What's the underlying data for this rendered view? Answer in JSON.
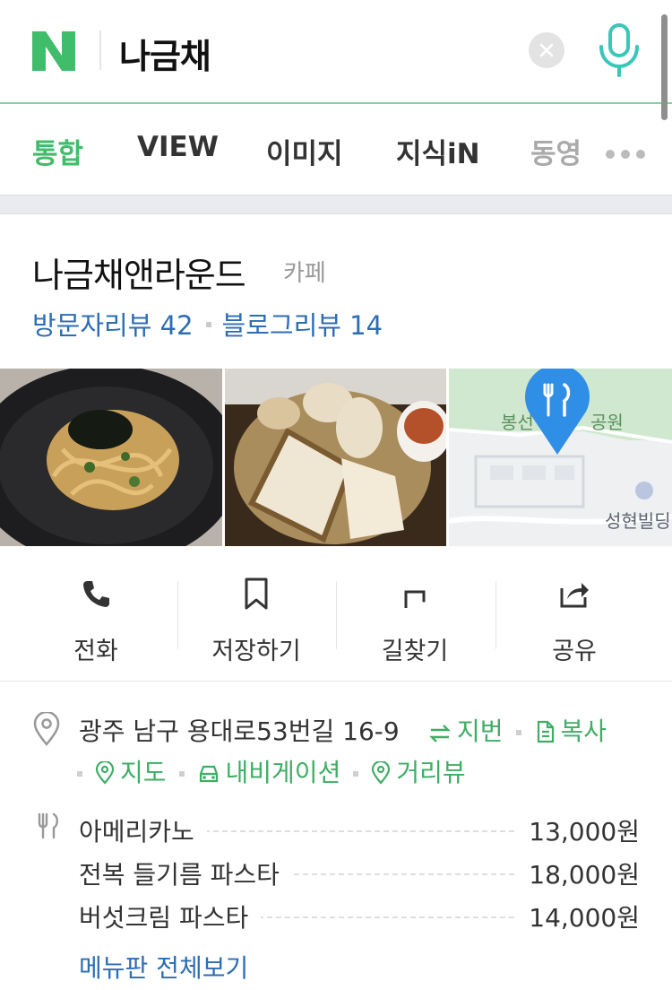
{
  "search": {
    "logo": "N",
    "query": "나금채"
  },
  "tabs": [
    {
      "label": "통합"
    },
    {
      "label": "VIEW"
    },
    {
      "label": "이미지"
    },
    {
      "label": "지식iN"
    },
    {
      "label": "동영"
    }
  ],
  "place": {
    "name": "나금채앤라운드",
    "category": "카페",
    "visitor_reviews": "방문자리뷰 42",
    "blog_reviews": "블로그리뷰 14"
  },
  "photos": [
    {
      "alt": "pasta-dish"
    },
    {
      "alt": "bread-basket"
    },
    {
      "alt": "map-thumbnail",
      "map_label_1": "봉선",
      "map_label_2": "공원",
      "map_label_3": "성현빌딩"
    }
  ],
  "actions": [
    {
      "label": "전화",
      "icon": "phone-icon"
    },
    {
      "label": "저장하기",
      "icon": "bookmark-icon"
    },
    {
      "label": "길찾기",
      "icon": "directions-icon"
    },
    {
      "label": "공유",
      "icon": "share-icon"
    }
  ],
  "address": {
    "text": "광주 남구 용대로53번길 16-9",
    "lot_number": "지번",
    "copy": "복사",
    "map": "지도",
    "navigation": "내비게이션",
    "street_view": "거리뷰"
  },
  "menu": {
    "items": [
      {
        "name": "아메리카노",
        "price": "13,000원"
      },
      {
        "name": "전복 들기름 파스타",
        "price": "18,000원"
      },
      {
        "name": "버섯크림 파스타",
        "price": "14,000원"
      }
    ],
    "view_all": "메뉴판 전체보기"
  },
  "colors": {
    "naver_green": "#3fbd6a",
    "link_blue": "#2c6db3",
    "link_green": "#3fae64",
    "mic_teal": "#3cc6b8",
    "map_pin": "#2f8ee5"
  }
}
